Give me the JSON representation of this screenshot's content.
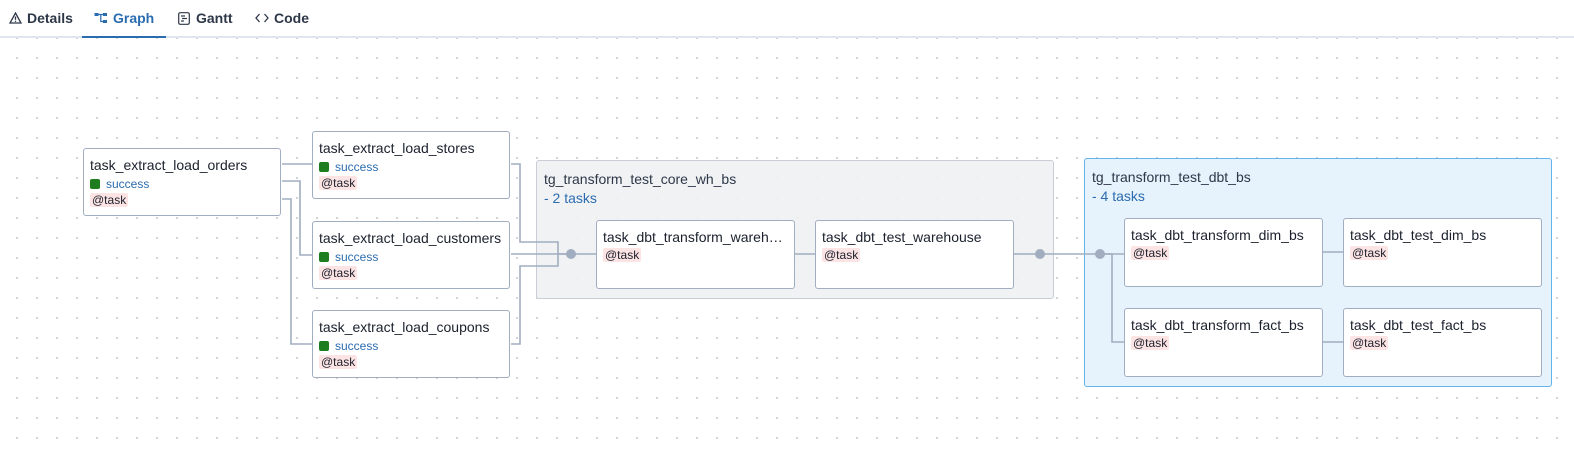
{
  "tabs": [
    {
      "label": "Details",
      "icon": "warning-triangle-icon"
    },
    {
      "label": "Graph",
      "icon": "graph-icon"
    },
    {
      "label": "Gantt",
      "icon": "gantt-icon"
    },
    {
      "label": "Code",
      "icon": "code-icon"
    }
  ],
  "active_tab": "Graph",
  "colors": {
    "accent": "#2b6cb0",
    "success": "#1e7d1e",
    "operator_bg": "#fde4e4",
    "group_blue_bg": "#e6f3fc"
  },
  "nodes": {
    "orders": {
      "name": "task_extract_load_orders",
      "status": "success",
      "operator": "@task"
    },
    "stores": {
      "name": "task_extract_load_stores",
      "status": "success",
      "operator": "@task"
    },
    "customers": {
      "name": "task_extract_load_customers",
      "status": "success",
      "operator": "@task"
    },
    "coupons": {
      "name": "task_extract_load_coupons",
      "status": "success",
      "operator": "@task"
    },
    "dbt_transform_wh": {
      "name": "task_dbt_transform_wareh…",
      "operator": "@task"
    },
    "dbt_test_wh": {
      "name": "task_dbt_test_warehouse",
      "operator": "@task"
    },
    "dbt_transform_dim": {
      "name": "task_dbt_transform_dim_bs",
      "operator": "@task"
    },
    "dbt_test_dim": {
      "name": "task_dbt_test_dim_bs",
      "operator": "@task"
    },
    "dbt_transform_fact": {
      "name": "task_dbt_transform_fact_bs",
      "operator": "@task"
    },
    "dbt_test_fact": {
      "name": "task_dbt_test_fact_bs",
      "operator": "@task"
    }
  },
  "groups": {
    "core_wh": {
      "title": "tg_transform_test_core_wh_bs",
      "count": "- 2 tasks"
    },
    "dbt": {
      "title": "tg_transform_test_dbt_bs",
      "count": "- 4 tasks"
    }
  }
}
